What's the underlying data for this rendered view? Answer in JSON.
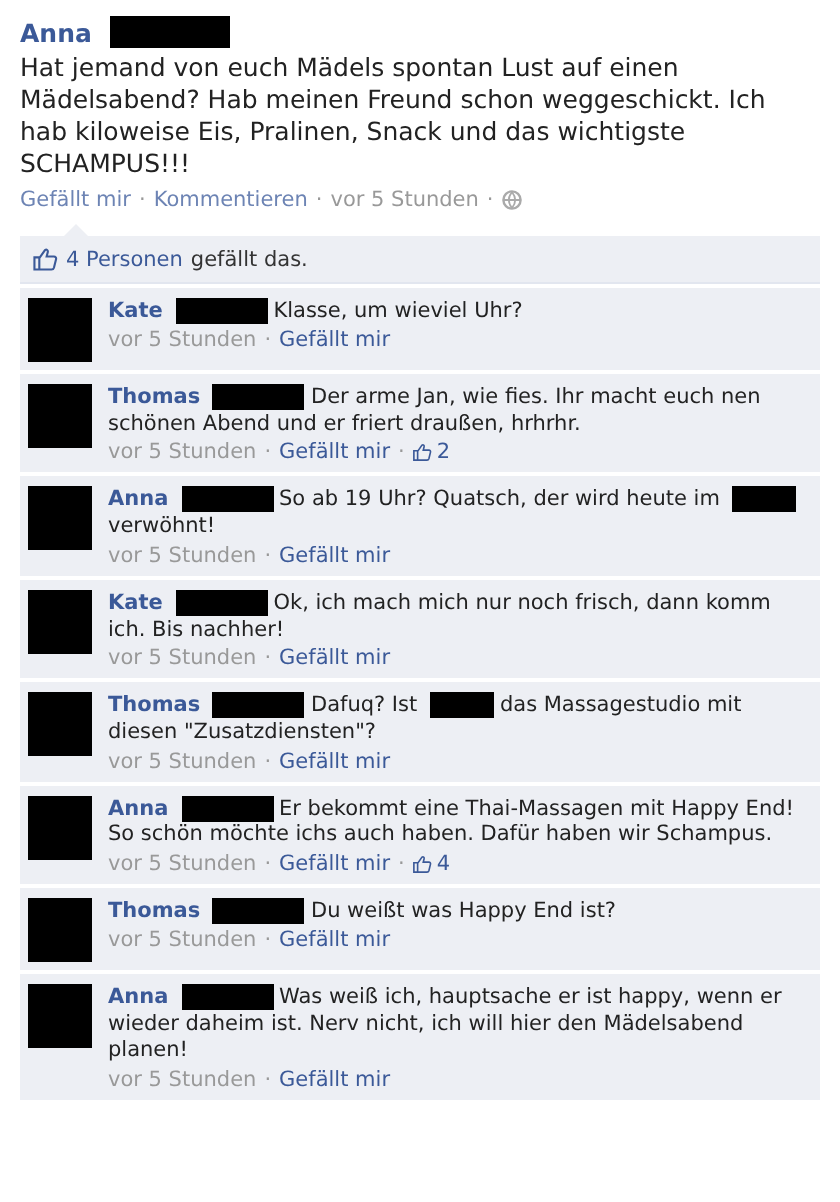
{
  "post": {
    "author": "Anna",
    "author_redacted": true,
    "text": "Hat jemand von euch Mädels spontan Lust auf einen Mädelsabend? Hab meinen Freund schon weggeschickt. Ich hab kiloweise Eis, Pralinen, Snack und das wichtigste SCHAMPUS!!!",
    "meta": [
      {
        "kind": "link",
        "text": "Gefällt mir"
      },
      {
        "kind": "sep",
        "text": "·"
      },
      {
        "kind": "link",
        "text": "Kommentieren"
      },
      {
        "kind": "sep",
        "text": "·"
      },
      {
        "kind": "time",
        "text": "vor 5 Stunden"
      },
      {
        "kind": "sep",
        "text": "·"
      },
      {
        "kind": "globe"
      }
    ]
  },
  "likes_bar": {
    "link": "4 Personen",
    "text": "gefällt das."
  },
  "comments": [
    {
      "author": "Kate",
      "parts": [
        {
          "kind": "redacted"
        },
        {
          "kind": "text",
          "text": "Klasse, um wieviel Uhr?"
        }
      ],
      "footer": [
        {
          "kind": "time",
          "text": "vor 5 Stunden"
        },
        {
          "kind": "sep",
          "text": "·"
        },
        {
          "kind": "link",
          "text": "Gefällt mir"
        }
      ]
    },
    {
      "author": "Thomas",
      "parts": [
        {
          "kind": "redacted"
        },
        {
          "kind": "text",
          "text": "Der arme Jan, wie fies. Ihr macht euch nen schönen Abend und er friert draußen, hrhrhr."
        }
      ],
      "footer": [
        {
          "kind": "time",
          "text": "vor 5 Stunden"
        },
        {
          "kind": "sep",
          "text": "·"
        },
        {
          "kind": "link",
          "text": "Gefällt mir"
        },
        {
          "kind": "sep",
          "text": "·"
        },
        {
          "kind": "likes",
          "text": "2"
        }
      ]
    },
    {
      "author": "Anna",
      "parts": [
        {
          "kind": "redacted"
        },
        {
          "kind": "text",
          "text": "So ab 19 Uhr? Quatsch, der wird heute im"
        },
        {
          "kind": "redacted"
        },
        {
          "kind": "text",
          "text": "verwöhnt!"
        }
      ],
      "footer": [
        {
          "kind": "time",
          "text": "vor 5 Stunden"
        },
        {
          "kind": "sep",
          "text": "·"
        },
        {
          "kind": "link",
          "text": "Gefällt mir"
        }
      ]
    },
    {
      "author": "Kate",
      "parts": [
        {
          "kind": "redacted"
        },
        {
          "kind": "text",
          "text": "Ok, ich mach mich nur noch frisch, dann komm ich. Bis nachher!"
        }
      ],
      "footer": [
        {
          "kind": "time",
          "text": "vor 5 Stunden"
        },
        {
          "kind": "sep",
          "text": "·"
        },
        {
          "kind": "link",
          "text": "Gefällt mir"
        }
      ]
    },
    {
      "author": "Thomas",
      "parts": [
        {
          "kind": "redacted"
        },
        {
          "kind": "text",
          "text": "Dafuq? Ist"
        },
        {
          "kind": "redacted"
        },
        {
          "kind": "text",
          "text": "das Massagestudio mit diesen \"Zusatzdiensten\"?"
        }
      ],
      "footer": [
        {
          "kind": "time",
          "text": "vor 5 Stunden"
        },
        {
          "kind": "sep",
          "text": "·"
        },
        {
          "kind": "link",
          "text": "Gefällt mir"
        }
      ]
    },
    {
      "author": "Anna",
      "parts": [
        {
          "kind": "redacted"
        },
        {
          "kind": "text",
          "text": "Er bekommt eine Thai-Massagen mit Happy End! So schön möchte ichs auch haben. Dafür haben wir Schampus."
        }
      ],
      "footer": [
        {
          "kind": "time",
          "text": "vor 5 Stunden"
        },
        {
          "kind": "sep",
          "text": "·"
        },
        {
          "kind": "link",
          "text": "Gefällt mir"
        },
        {
          "kind": "sep",
          "text": "·"
        },
        {
          "kind": "likes",
          "text": "4"
        }
      ]
    },
    {
      "author": "Thomas",
      "parts": [
        {
          "kind": "redacted"
        },
        {
          "kind": "text",
          "text": "Du weißt was Happy End ist?"
        }
      ],
      "footer": [
        {
          "kind": "time",
          "text": "vor 5 Stunden"
        },
        {
          "kind": "sep",
          "text": "·"
        },
        {
          "kind": "link",
          "text": "Gefällt mir"
        }
      ]
    },
    {
      "author": "Anna",
      "parts": [
        {
          "kind": "redacted"
        },
        {
          "kind": "text",
          "text": "Was weiß ich, hauptsache er ist happy, wenn er wieder daheim ist. Nerv nicht, ich will hier den Mädelsabend planen!"
        }
      ],
      "footer": [
        {
          "kind": "time",
          "text": "vor 5 Stunden"
        },
        {
          "kind": "sep",
          "text": "·"
        },
        {
          "kind": "link",
          "text": "Gefällt mir"
        }
      ]
    }
  ]
}
